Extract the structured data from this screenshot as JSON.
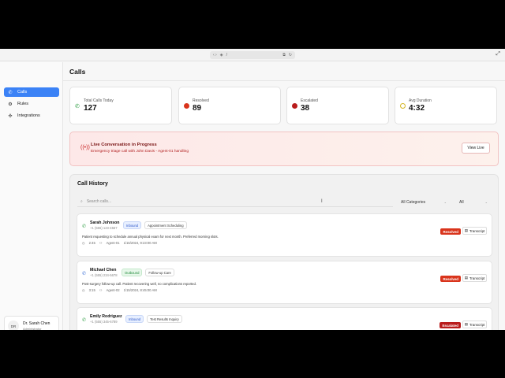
{
  "browser": {
    "nav_glyphs": "‹ ›",
    "url": "/"
  },
  "sidebar": {
    "items": [
      {
        "label": "Calls",
        "icon": "phone-icon"
      },
      {
        "label": "Rules",
        "icon": "gear-icon"
      },
      {
        "label": "Integrations",
        "icon": "plug-icon"
      }
    ],
    "user": {
      "initials": "DR",
      "name": "Dr. Sarah Chen",
      "role": "Administrator"
    }
  },
  "page": {
    "title": "Calls"
  },
  "stats": [
    {
      "label": "Total Calls Today",
      "value": "127",
      "icon": "phone-icon",
      "color": "#2f9e44"
    },
    {
      "label": "Resolved",
      "value": "89",
      "icon": "dot-icon",
      "color": "#d9341c"
    },
    {
      "label": "Escalated",
      "value": "38",
      "icon": "dot-icon",
      "color": "#b91c1c"
    },
    {
      "label": "Avg Duration",
      "value": "4:32",
      "icon": "clock-icon",
      "color": "#d4b623"
    }
  ],
  "live": {
    "title": "Live Conversation in Progress",
    "subtitle": "Emergency triage call with John Davis - Agent-01 handling",
    "button": "View Live"
  },
  "history": {
    "title": "Call History",
    "search_placeholder": "Search calls...",
    "category_filter": "All Categories",
    "status_filter": "All",
    "calls": [
      {
        "name": "Sarah Johnson",
        "number": "+1 (555) 123-4567",
        "direction": "Inbound",
        "category": "Appointment Scheduling",
        "description": "Patient requesting to schedule annual physical exam for next month. Preferred morning slots.",
        "duration": "2:45",
        "agent": "Agent-01",
        "time": "1/15/2024, 9:23:00 AM",
        "status": "Resolved",
        "transcript": "Transcript"
      },
      {
        "name": "Michael Chen",
        "number": "+1 (555) 234-5678",
        "direction": "Outbound",
        "category": "Follow-up Care",
        "description": "Post-surgery follow-up call. Patient recovering well, no complications reported.",
        "duration": "3:15",
        "agent": "Agent-02",
        "time": "1/15/2024, 8:45:00 AM",
        "status": "Resolved",
        "transcript": "Transcript"
      },
      {
        "name": "Emily Rodriguez",
        "number": "+1 (555) 345-6789",
        "direction": "Inbound",
        "category": "Test Results Inquiry",
        "description": "",
        "duration": "",
        "agent": "",
        "time": "",
        "status": "Escalated",
        "transcript": "Transcript"
      }
    ]
  }
}
